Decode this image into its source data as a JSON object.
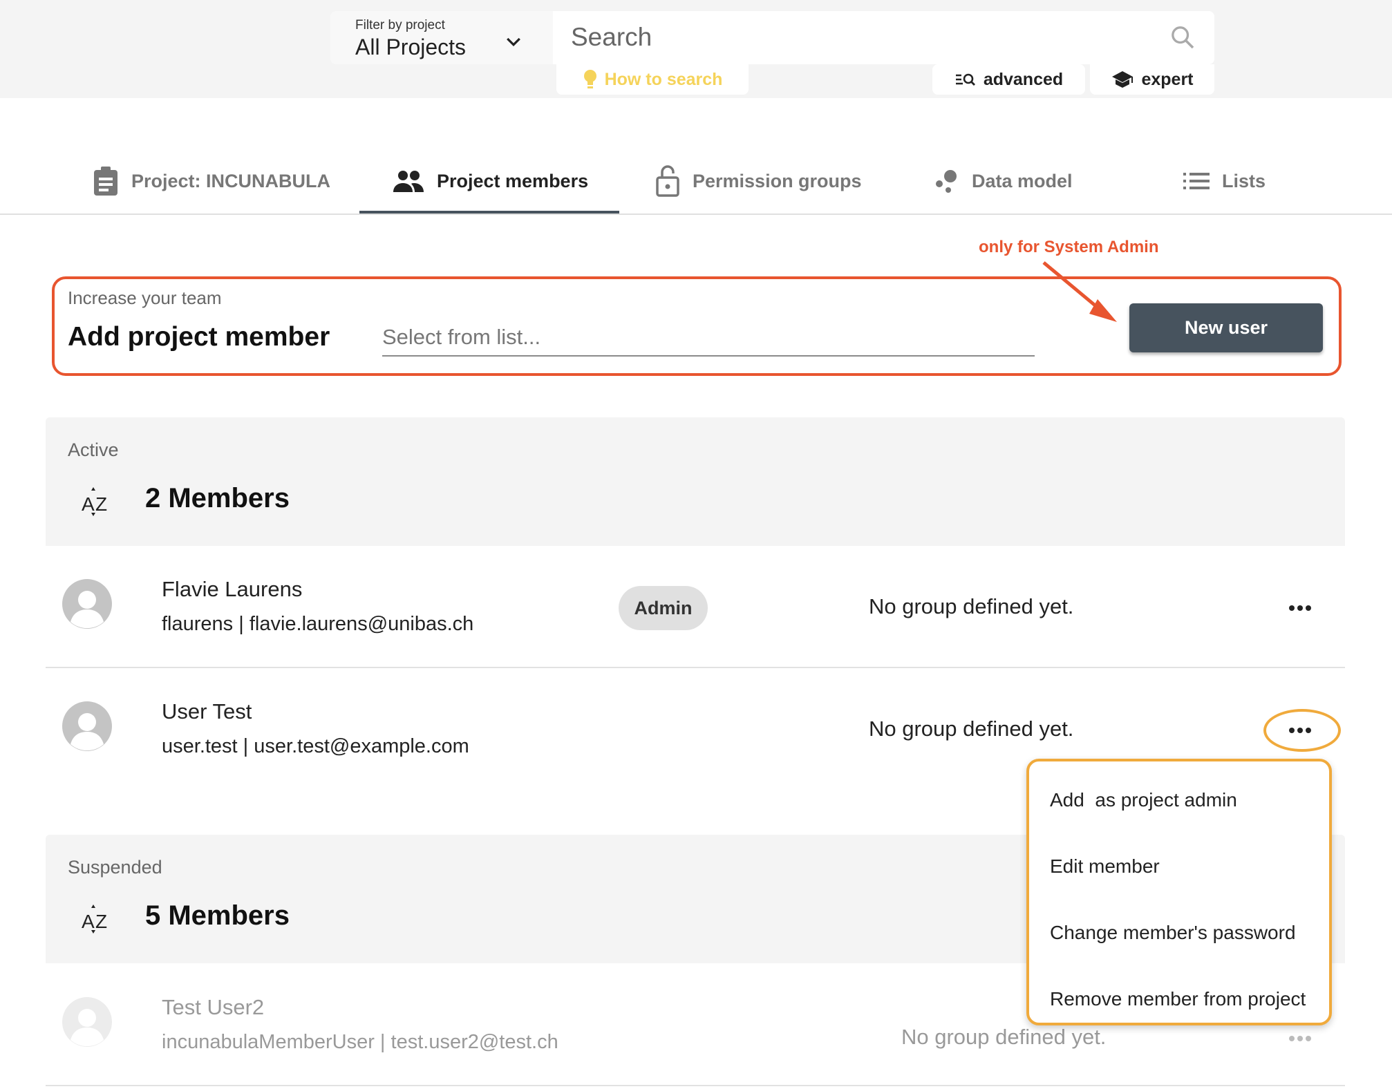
{
  "header": {
    "filter_label": "Filter by project",
    "filter_value": "All Projects",
    "search_placeholder": "Search",
    "how_to_search": "How to search",
    "advanced": "advanced",
    "expert": "expert"
  },
  "tabs": [
    {
      "label": "Project: INCUNABULA",
      "icon": "clipboard-icon",
      "active": false
    },
    {
      "label": "Project members",
      "icon": "people-icon",
      "active": true
    },
    {
      "label": "Permission groups",
      "icon": "lock-icon",
      "active": false
    },
    {
      "label": "Data model",
      "icon": "bubbles-icon",
      "active": false
    },
    {
      "label": "Lists",
      "icon": "list-icon",
      "active": false
    }
  ],
  "annotation": {
    "note": "only for System Admin",
    "note_color": "#e8552f",
    "highlight_color": "#f0aa3c"
  },
  "add_member": {
    "subtitle": "Increase your team",
    "title": "Add project member",
    "select_placeholder": "Select from list...",
    "new_user_label": "New user"
  },
  "sections": {
    "active": {
      "label": "Active",
      "count_label": "2 Members",
      "members": [
        {
          "name": "Flavie Laurens",
          "sub": "flaurens | flavie.laurens@unibas.ch",
          "badge": "Admin",
          "groups": "No group defined yet."
        },
        {
          "name": "User Test",
          "sub": "user.test | user.test@example.com",
          "badge": null,
          "groups": "No group defined yet."
        }
      ]
    },
    "suspended": {
      "label": "Suspended",
      "count_label": "5 Members",
      "members": [
        {
          "name": "Test User2",
          "sub": "incunabulaMemberUser | test.user2@test.ch",
          "groups": "No group defined yet."
        }
      ]
    }
  },
  "context_menu": {
    "items": [
      "Add  as project admin",
      "Edit member",
      "Change member's password",
      "Remove member from project"
    ]
  },
  "colors": {
    "primary": "#47535e",
    "how_to_search": "#f5d35a"
  }
}
